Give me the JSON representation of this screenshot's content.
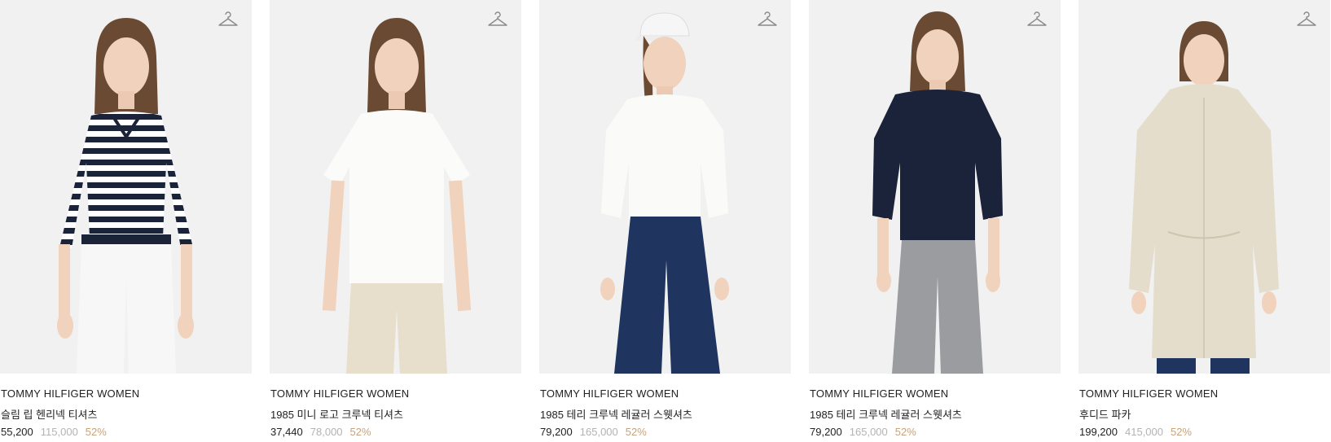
{
  "icons": {
    "wishlist": "hanger-icon"
  },
  "colors": {
    "image_bg": "#f1f1f1",
    "discount": "#c7a27a",
    "original_price": "#b3b3b3"
  },
  "products": [
    {
      "brand": "TOMMY HILFIGER WOMEN",
      "name": "슬림 립 헨리넥 티셔츠",
      "price": "55,200",
      "original_price": "115,000",
      "discount": "52%",
      "image": "model-striped-henley-tee"
    },
    {
      "brand": "TOMMY HILFIGER WOMEN",
      "name": "1985 미니 로고 크루넥 티셔츠",
      "price": "37,440",
      "original_price": "78,000",
      "discount": "52%",
      "image": "model-white-crew-tee"
    },
    {
      "brand": "TOMMY HILFIGER WOMEN",
      "name": "1985 테리 크루넥 레귤러 스웻셔츠",
      "price": "79,200",
      "original_price": "165,000",
      "discount": "52%",
      "image": "model-white-sweatshirt"
    },
    {
      "brand": "TOMMY HILFIGER WOMEN",
      "name": "1985 테리 크루넥 레귤러 스웻셔츠",
      "price": "79,200",
      "original_price": "165,000",
      "discount": "52%",
      "image": "model-navy-sweatshirt"
    },
    {
      "brand": "TOMMY HILFIGER WOMEN",
      "name": "후디드 파카",
      "price": "199,200",
      "original_price": "415,000",
      "discount": "52%",
      "image": "model-beige-parka"
    }
  ]
}
